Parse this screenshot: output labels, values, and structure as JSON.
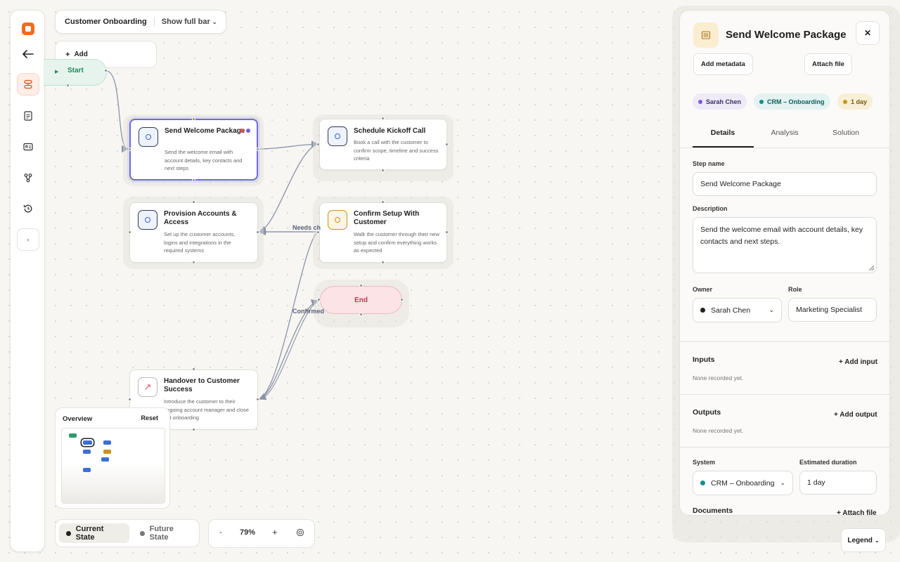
{
  "project": {
    "title": "Customer Onboarding",
    "show_full_bar": "Show full bar",
    "add_label": "Add"
  },
  "start_label": "Start",
  "end_label": "End",
  "steps": [
    {
      "title": "Send Welcome Package",
      "desc": "Send the welcome email with account details, key contacts and next steps"
    },
    {
      "title": "Schedule Kickoff Call",
      "desc": "Book a call with the customer to confirm scope, timeline and success criteria"
    },
    {
      "title": "Provision Accounts & Access",
      "desc": "Set up the customer accounts, logins and integrations in the required systems"
    },
    {
      "title": "Confirm Setup With Customer",
      "desc": "Walk the customer through their new setup and confirm everything works as expected"
    },
    {
      "title": "Handover to Customer Success",
      "desc": "Introduce the customer to their ongoing account manager and close out onboarding"
    }
  ],
  "edge_labels": {
    "needs_changes": "Needs ch",
    "confirmed": "Confirmed"
  },
  "overview": {
    "title": "Overview",
    "reset": "Reset"
  },
  "states": {
    "current": "Current State",
    "future": "Future State"
  },
  "zoom": {
    "minus": "-",
    "value": "79%",
    "plus": "+"
  },
  "legend": "Legend",
  "panel": {
    "title": "Send Welcome Package",
    "add_metadata": "Add metadata",
    "attach_file": "Attach file",
    "chips": {
      "owner": "Sarah Chen",
      "system": "CRM – Onboarding",
      "duration": "1 day"
    },
    "tabs": [
      "Details",
      "Analysis",
      "Solution"
    ],
    "step_name_label": "Step name",
    "step_name_value": "Send Welcome Package",
    "description_label": "Description",
    "description_value": "Send the welcome email with account details, key contacts and next steps.",
    "owner_label": "Owner",
    "owner_value": "Sarah Chen",
    "role_label": "Role",
    "role_value": "Marketing Specialist",
    "inputs_title": "Inputs",
    "add_input": "+ Add input",
    "inputs_empty": "None recorded yet.",
    "outputs_title": "Outputs",
    "add_output": "+ Add output",
    "outputs_empty": "None recorded yet.",
    "system_label": "System",
    "system_value": "CRM – Onboarding",
    "duration_label": "Estimated duration",
    "duration_value": "1 day",
    "documents_title": "Documents",
    "attach_file_action": "+ Attach file"
  },
  "colors": {
    "accent": "#6b6be0",
    "brand_orange": "#f26b1d",
    "start_green": "#1f8a5a",
    "end_red": "#c5384e",
    "owner_dot": "#7c5cd6",
    "system_dot": "#12908e",
    "duration_dot": "#c8951c"
  },
  "icons": {
    "rail": [
      "logo-icon",
      "back-arrow-icon",
      "process-map-icon",
      "document-icon",
      "id-card-icon",
      "branch-icon",
      "history-icon",
      "expand-chevron-icon"
    ],
    "panel": "document-lines-icon"
  }
}
